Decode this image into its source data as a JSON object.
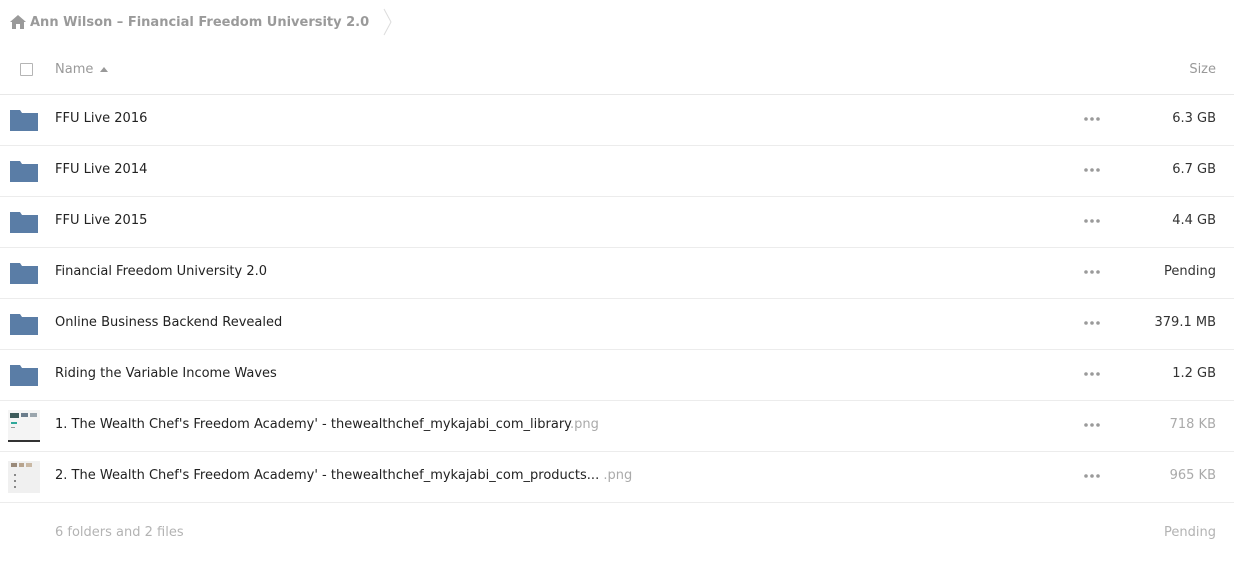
{
  "breadcrumb": {
    "label": "Ann Wilson – Financial Freedom University 2.0"
  },
  "header": {
    "name_label": "Name",
    "size_label": "Size"
  },
  "items": [
    {
      "type": "folder",
      "name": "FFU Live 2016",
      "ext": "",
      "size": "6.3 GB",
      "muted": false
    },
    {
      "type": "folder",
      "name": "FFU Live 2014",
      "ext": "",
      "size": "6.7 GB",
      "muted": false
    },
    {
      "type": "folder",
      "name": "FFU Live 2015",
      "ext": "",
      "size": "4.4 GB",
      "muted": false
    },
    {
      "type": "folder",
      "name": "Financial Freedom University 2.0",
      "ext": "",
      "size": "Pending",
      "muted": false
    },
    {
      "type": "folder",
      "name": "Online Business Backend Revealed",
      "ext": "",
      "size": "379.1 MB",
      "muted": false
    },
    {
      "type": "folder",
      "name": "Riding the Variable Income Waves",
      "ext": "",
      "size": "1.2 GB",
      "muted": false
    },
    {
      "type": "image",
      "name": "1. The Wealth Chef's Freedom Academy' - thewealthchef_mykajabi_com_library",
      "ext": ".png",
      "size": "718 KB",
      "muted": true
    },
    {
      "type": "image",
      "name": "2. The Wealth Chef's Freedom Academy' - thewealthchef_mykajabi_com_products...",
      "ext": " .png",
      "size": "965 KB",
      "muted": true
    }
  ],
  "footer": {
    "summary": "6 folders and 2 files",
    "total": "Pending"
  },
  "colors": {
    "folder": "#5a7da6",
    "muted_text": "#aaaaaa"
  }
}
